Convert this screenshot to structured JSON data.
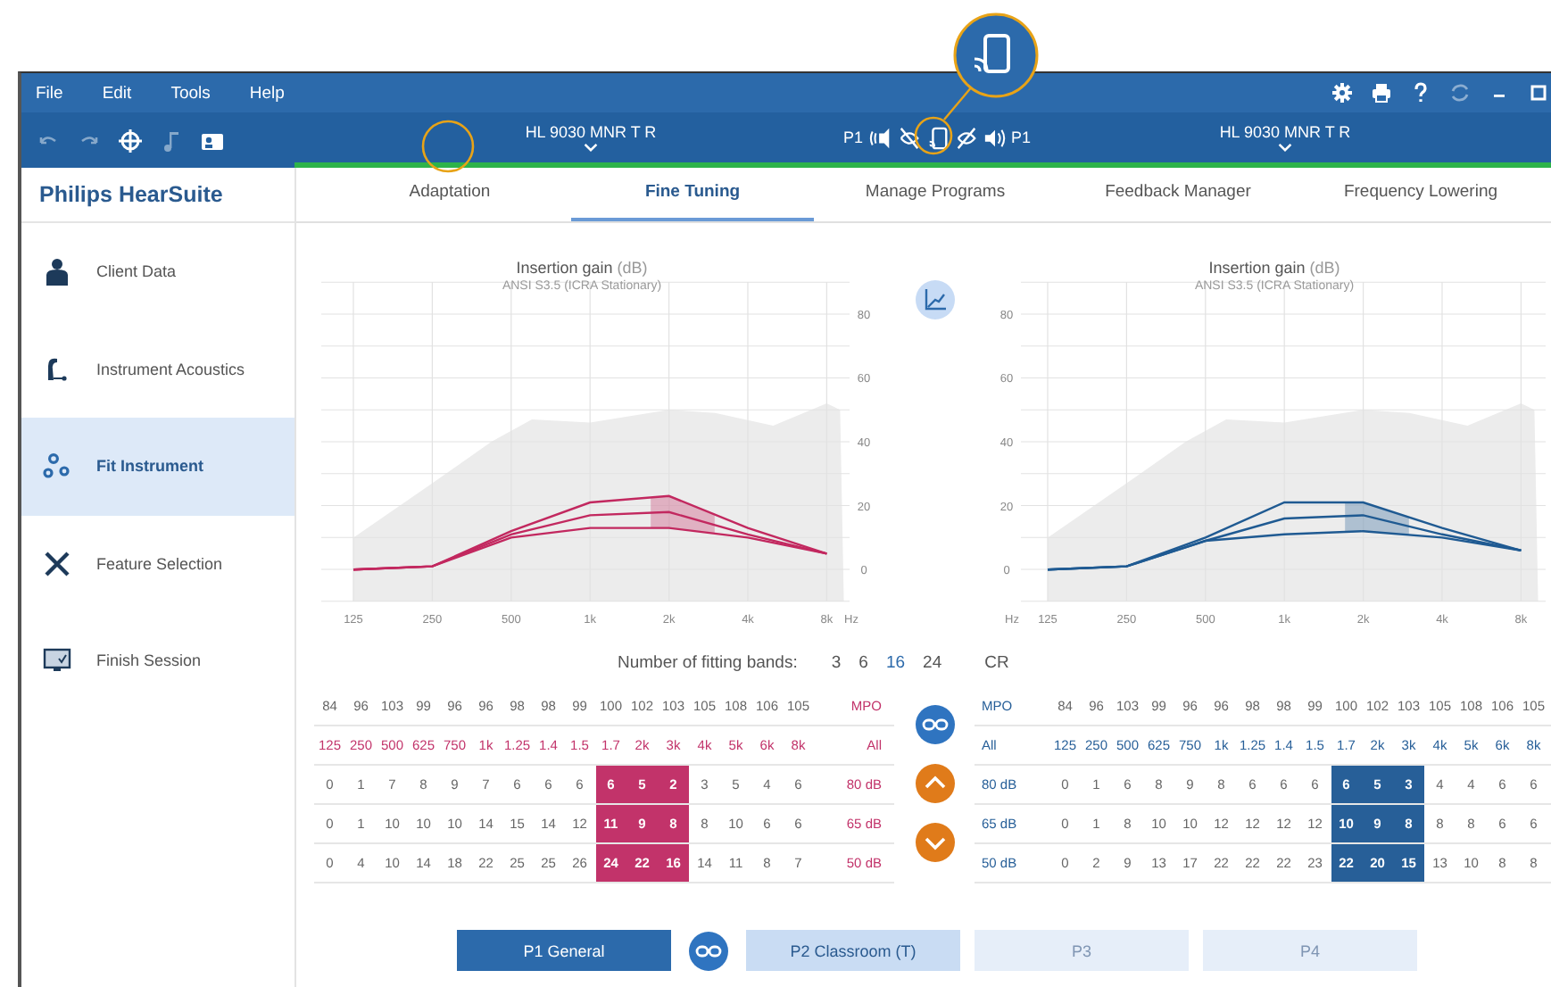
{
  "menu": [
    "File",
    "Edit",
    "Tools",
    "Help"
  ],
  "window_icons": [
    {
      "kind": "gear",
      "disabled": false
    },
    {
      "kind": "print",
      "disabled": false
    },
    {
      "kind": "help",
      "disabled": false
    },
    {
      "kind": "refresh",
      "disabled": true
    },
    {
      "kind": "minimize",
      "disabled": false
    },
    {
      "kind": "maximize",
      "disabled": false
    }
  ],
  "toolbar_icons": [
    {
      "kind": "undo",
      "disabled": true
    },
    {
      "kind": "redo",
      "disabled": true
    },
    {
      "kind": "target",
      "disabled": false
    },
    {
      "kind": "music",
      "disabled": true
    },
    {
      "kind": "camera",
      "disabled": false
    }
  ],
  "devices": {
    "left": "HL 9030 MNR T R",
    "program_left": "P1",
    "program_right": "P1",
    "right": "HL 9030 MNR T R"
  },
  "app_title": "Philips HearSuite",
  "sidebar": {
    "items": [
      {
        "label": "Client Data",
        "kind": "person",
        "selected": false
      },
      {
        "label": "Instrument Acoustics",
        "kind": "hearing-aid",
        "selected": false
      },
      {
        "label": "Fit Instrument",
        "kind": "gears",
        "selected": true
      },
      {
        "label": "Feature Selection",
        "kind": "tools",
        "selected": false
      },
      {
        "label": "Finish Session",
        "kind": "monitor",
        "selected": false
      }
    ]
  },
  "tabs": [
    {
      "label": "Adaptation",
      "selected": false
    },
    {
      "label": "Fine Tuning",
      "selected": true
    },
    {
      "label": "Manage Programs",
      "selected": false
    },
    {
      "label": "Feedback Manager",
      "selected": false
    },
    {
      "label": "Frequency Lowering",
      "selected": false
    }
  ],
  "charts": [
    {
      "title": "Insertion gain",
      "unit": "(dB)",
      "subtitle": "ANSI S3.5 (ICRA Stationary)",
      "chart_data": {
        "type": "line",
        "xlabel": "Hz",
        "categories": [
          "125",
          "250",
          "500",
          "1k",
          "2k",
          "4k",
          "8k"
        ],
        "yticks": [
          0,
          20,
          40,
          60,
          80
        ],
        "ylim": [
          -10,
          90
        ],
        "grid": true,
        "series": [
          {
            "color": "#c2285f",
            "values": [
              0,
              1,
              12,
              21,
              23,
              13,
              5
            ]
          },
          {
            "color": "#c2285f",
            "values": [
              0,
              1,
              11,
              17,
              18,
              11,
              5
            ]
          },
          {
            "color": "#c2285f",
            "values": [
              0,
              1,
              10,
              13,
              13,
              10,
              5
            ]
          }
        ]
      }
    },
    {
      "title": "Insertion gain",
      "unit": "(dB)",
      "subtitle": "ANSI S3.5 (ICRA Stationary)",
      "chart_data": {
        "type": "line",
        "xlabel": "Hz",
        "categories": [
          "125",
          "250",
          "500",
          "1k",
          "2k",
          "4k",
          "8k"
        ],
        "yticks": [
          0,
          20,
          40,
          60,
          80
        ],
        "ylim": [
          -10,
          90
        ],
        "grid": true,
        "series": [
          {
            "color": "#1f5a92",
            "values": [
              0,
              1,
              10,
              21,
              21,
              13,
              6
            ]
          },
          {
            "color": "#1f5a92",
            "values": [
              0,
              1,
              9,
              16,
              17,
              11,
              6
            ]
          },
          {
            "color": "#1f5a92",
            "values": [
              0,
              1,
              9,
              11,
              12,
              10,
              6
            ]
          }
        ]
      }
    }
  ],
  "fitting_bands": {
    "label": "Number of fitting bands:",
    "options": [
      {
        "label": "3",
        "selected": false
      },
      {
        "label": "6",
        "selected": false
      },
      {
        "label": "16",
        "selected": true
      },
      {
        "label": "24",
        "selected": false
      }
    ],
    "cr": "CR"
  },
  "tables": [
    {
      "color": "#c2336a",
      "mpo_label": "MPO",
      "mpo": [
        "84",
        "96",
        "103",
        "99",
        "96",
        "96",
        "98",
        "98",
        "99",
        "100",
        "102",
        "103",
        "105",
        "108",
        "106",
        "105"
      ],
      "all_label": "All",
      "bands": [
        {
          "label": "125",
          "selected": false
        },
        {
          "label": "250",
          "selected": false
        },
        {
          "label": "500",
          "selected": false
        },
        {
          "label": "625",
          "selected": false
        },
        {
          "label": "750",
          "selected": false
        },
        {
          "label": "1k",
          "selected": false
        },
        {
          "label": "1.25",
          "selected": false
        },
        {
          "label": "1.4",
          "selected": false
        },
        {
          "label": "1.5",
          "selected": false
        },
        {
          "label": "1.7",
          "selected": true
        },
        {
          "label": "2k",
          "selected": true
        },
        {
          "label": "3k",
          "selected": true
        },
        {
          "label": "4k",
          "selected": false
        },
        {
          "label": "5k",
          "selected": false
        },
        {
          "label": "6k",
          "selected": false
        },
        {
          "label": "8k",
          "selected": false
        }
      ],
      "rows": [
        {
          "label": "80 dB",
          "values": [
            "0",
            "1",
            "7",
            "8",
            "9",
            "7",
            "6",
            "6",
            "6",
            "6",
            "5",
            "2",
            "3",
            "5",
            "4",
            "6"
          ]
        },
        {
          "label": "65 dB",
          "values": [
            "0",
            "1",
            "10",
            "10",
            "10",
            "14",
            "15",
            "14",
            "12",
            "11",
            "9",
            "8",
            "8",
            "10",
            "6",
            "6"
          ]
        },
        {
          "label": "50 dB",
          "values": [
            "0",
            "4",
            "10",
            "14",
            "18",
            "22",
            "25",
            "25",
            "26",
            "24",
            "22",
            "16",
            "14",
            "11",
            "8",
            "7"
          ]
        }
      ]
    },
    {
      "color": "#275f98",
      "mpo_label": "MPO",
      "mpo": [
        "84",
        "96",
        "103",
        "99",
        "96",
        "96",
        "98",
        "98",
        "99",
        "100",
        "102",
        "103",
        "105",
        "108",
        "106",
        "105"
      ],
      "all_label": "All",
      "bands": [
        {
          "label": "125",
          "selected": false
        },
        {
          "label": "250",
          "selected": false
        },
        {
          "label": "500",
          "selected": false
        },
        {
          "label": "625",
          "selected": false
        },
        {
          "label": "750",
          "selected": false
        },
        {
          "label": "1k",
          "selected": false
        },
        {
          "label": "1.25",
          "selected": false
        },
        {
          "label": "1.4",
          "selected": false
        },
        {
          "label": "1.5",
          "selected": false
        },
        {
          "label": "1.7",
          "selected": true
        },
        {
          "label": "2k",
          "selected": true
        },
        {
          "label": "3k",
          "selected": true
        },
        {
          "label": "4k",
          "selected": false
        },
        {
          "label": "5k",
          "selected": false
        },
        {
          "label": "6k",
          "selected": false
        },
        {
          "label": "8k",
          "selected": false
        }
      ],
      "rows": [
        {
          "label": "80 dB",
          "values": [
            "0",
            "1",
            "6",
            "8",
            "9",
            "8",
            "6",
            "6",
            "6",
            "6",
            "5",
            "3",
            "4",
            "4",
            "6",
            "6"
          ]
        },
        {
          "label": "65 dB",
          "values": [
            "0",
            "1",
            "8",
            "10",
            "10",
            "12",
            "12",
            "12",
            "12",
            "10",
            "9",
            "8",
            "8",
            "8",
            "6",
            "6"
          ]
        },
        {
          "label": "50 dB",
          "values": [
            "0",
            "2",
            "9",
            "13",
            "17",
            "22",
            "22",
            "22",
            "23",
            "22",
            "20",
            "15",
            "13",
            "10",
            "8",
            "8"
          ]
        }
      ]
    }
  ],
  "programs": [
    {
      "label": "P1 General",
      "selected": true,
      "disabled": false
    },
    {
      "label": "P2 Classroom (T)",
      "selected": false,
      "disabled": false
    },
    {
      "label": "P3",
      "selected": false,
      "disabled": true
    },
    {
      "label": "P4",
      "selected": false,
      "disabled": true
    }
  ]
}
